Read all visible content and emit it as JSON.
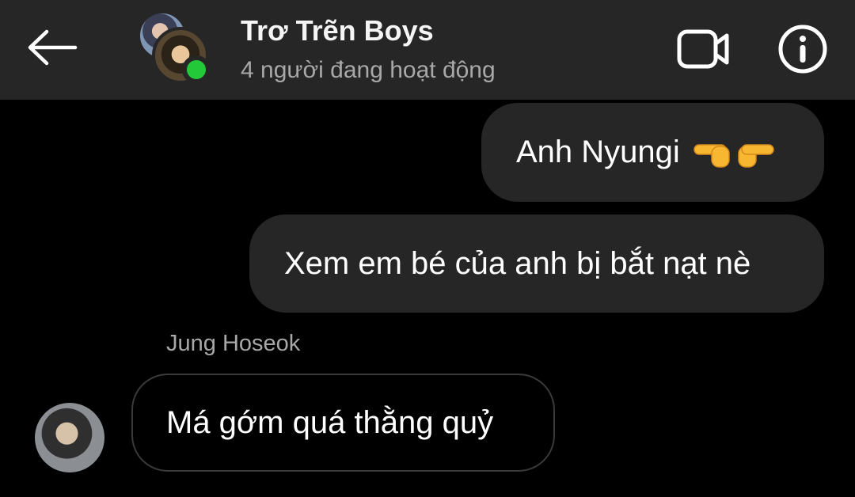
{
  "header": {
    "title": "Trơ Trẽn Boys",
    "status": "4 người đang hoạt động",
    "back_icon": "arrow-left-icon",
    "video_icon": "video-camera-icon",
    "info_icon": "info-circle-icon"
  },
  "messages": [
    {
      "direction": "outgoing",
      "text": "Anh Nyungi",
      "emoji": "👉👈"
    },
    {
      "direction": "outgoing",
      "text": "Xem em bé của anh bị bắt nạt nè"
    },
    {
      "direction": "incoming",
      "sender": "Jung Hoseok",
      "text": "Má gớm quá thằng quỷ"
    }
  ],
  "colors": {
    "background": "#000000",
    "header": "#262626",
    "outgoing_bubble": "#262626",
    "incoming_border": "#3a3a3a",
    "online": "#24c93a",
    "secondary_text": "#a8a8a8"
  }
}
